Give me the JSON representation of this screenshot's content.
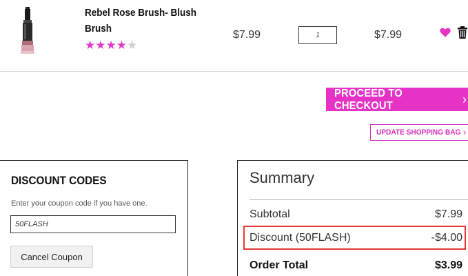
{
  "product": {
    "name": "Rebel Rose Brush- Blush Brush",
    "rating": 4,
    "rating_max": 5,
    "unit_price": "$7.99",
    "quantity": "1",
    "line_total": "$7.99",
    "image_icon": "makeup-brush-image",
    "favorite_icon": "heart-icon",
    "delete_icon": "trash-icon"
  },
  "actions": {
    "checkout_label": "PROCEED TO CHECKOUT",
    "checkout_arrow": "›",
    "update_label": "UPDATE SHOPPING BAG",
    "update_arrow": "›"
  },
  "discount": {
    "title": "DISCOUNT CODES",
    "help_text": "Enter your coupon code if you have one.",
    "code_value": "50FLASH",
    "cancel_label": "Cancel Coupon"
  },
  "summary": {
    "title": "Summary",
    "subtotal_label": "Subtotal",
    "subtotal_value": "$7.99",
    "discount_label": "Discount (50FLASH)",
    "discount_value": "-$4.00",
    "total_label": "Order Total",
    "total_value": "$3.99"
  },
  "colors": {
    "accent": "#e633c6",
    "highlight_border": "#e53935",
    "star_inactive": "#cfcfcf"
  }
}
